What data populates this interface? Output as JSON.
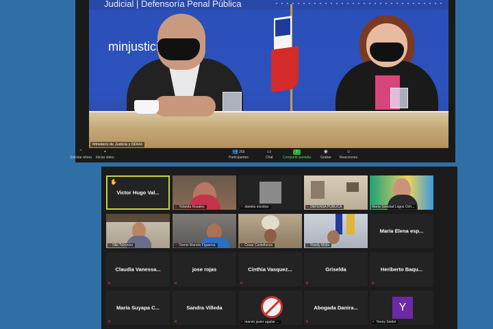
{
  "top_video": {
    "banner_text": "Judicial | Defensoría Penal Pública",
    "site_text": "minjusticia.g",
    "name_tag": "Ministerio de Justicia y DDHH"
  },
  "toolbar": {
    "items": [
      {
        "label": "Iniciar video",
        "icon": "video-icon"
      },
      {
        "label": "Participantes",
        "icon": "participants-icon",
        "count": "265"
      },
      {
        "label": "Chat",
        "icon": "chat-icon"
      },
      {
        "label": "Compartir pantalla",
        "icon": "share-screen-icon"
      },
      {
        "label": "Grabar",
        "icon": "record-icon"
      },
      {
        "label": "Reacciones",
        "icon": "reactions-icon"
      }
    ],
    "partial_left": "Solicitar ahora",
    "accent_color": "#27b03a"
  },
  "gallery": {
    "tiles": [
      {
        "name": "Victor Hugo Val...",
        "type": "name",
        "active": true,
        "hand": true
      },
      {
        "name": "Yolanda Rosales",
        "type": "video",
        "scene": "woman-red"
      },
      {
        "name": "daniela escobar",
        "type": "video",
        "scene": "gray-box"
      },
      {
        "name": "DEFENSA PUBLICA",
        "type": "video",
        "scene": "office"
      },
      {
        "name": "María Soledad Lagos Och...",
        "type": "video",
        "scene": "woman-bright"
      },
      {
        "name": "Nila Toloveno",
        "type": "video",
        "scene": "woman-desk"
      },
      {
        "name": "Osmin Manolo Figueroa",
        "type": "video",
        "scene": "man-blue"
      },
      {
        "name": "Cesar Castellanos",
        "type": "video",
        "scene": "man-room"
      },
      {
        "name": "Randy Mejia",
        "type": "video",
        "scene": "man-flag"
      },
      {
        "name": "Maria Elena esp...",
        "type": "name"
      },
      {
        "name": "Claudia Vanessa...",
        "type": "name"
      },
      {
        "name": "jose rojas",
        "type": "name"
      },
      {
        "name": "Cinthia Vasquez...",
        "type": "name"
      },
      {
        "name": "Griselda",
        "type": "name"
      },
      {
        "name": "Heriberto Baqu...",
        "type": "name"
      },
      {
        "name": "Maria Suyapa C...",
        "type": "name"
      },
      {
        "name": "Sandra Villeda",
        "type": "name"
      },
      {
        "name": "marvin javier aguilar ...",
        "type": "video",
        "scene": "no-sign"
      },
      {
        "name": "Abogada Danira...",
        "type": "name"
      },
      {
        "name": "Yenny Seidel",
        "type": "avatar",
        "letter": "Y"
      }
    ]
  }
}
